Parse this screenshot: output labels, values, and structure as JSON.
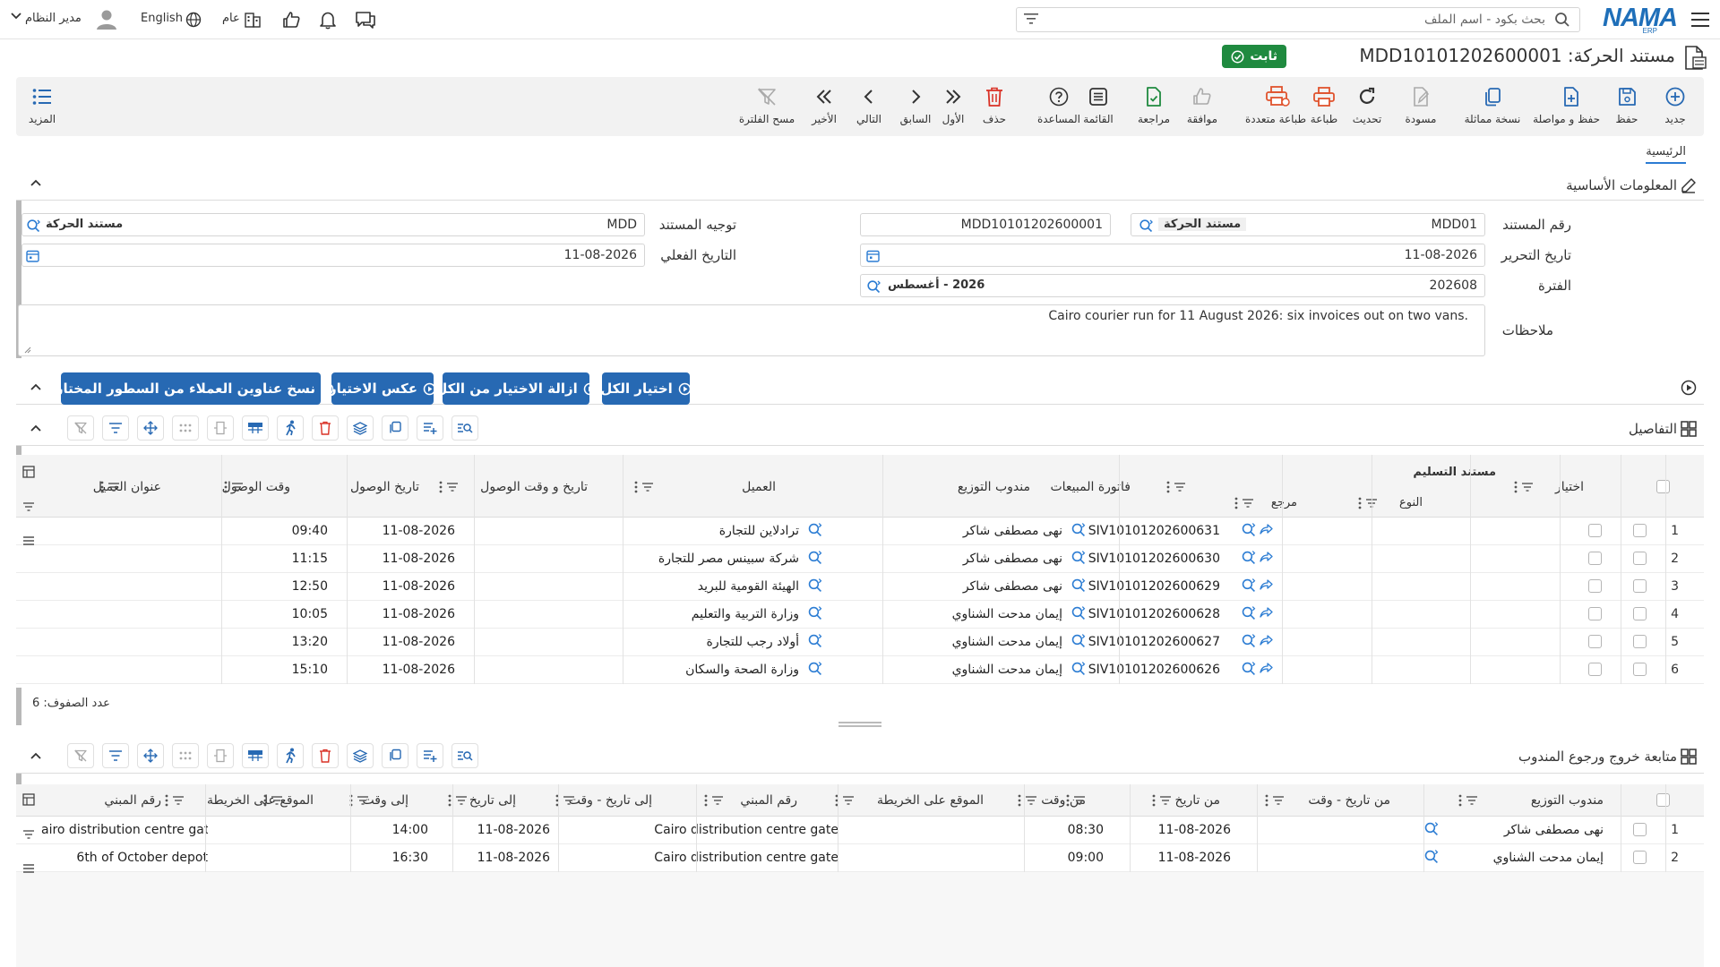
{
  "topbar": {
    "brand": "NAMA",
    "brand_sub": "ERP",
    "search_placeholder": "بحث بكود - اسم الملف",
    "user_name": "مدير النظام",
    "language": "English",
    "scope": "عام"
  },
  "title": {
    "label": "مستند الحركة: MDD10101202600001",
    "status": "ثابت"
  },
  "toolbar": [
    {
      "label": "جديد",
      "icon": "plus-circle-icon",
      "color": "#2769b3"
    },
    {
      "label": "حفظ",
      "icon": "save-icon",
      "color": "#2769b3"
    },
    {
      "label": "حفظ و مواصلة",
      "icon": "save-continue-icon",
      "color": "#2769b3"
    },
    {
      "label": "نسخة مماثلة",
      "icon": "copy-icon",
      "color": "#2769b3"
    },
    {
      "label": "مسودة",
      "icon": "draft-icon",
      "color": "#aaaaaa"
    },
    {
      "label": "تحديث",
      "icon": "refresh-icon",
      "color": "#333333"
    },
    {
      "label": "طباعة",
      "icon": "print-icon",
      "color": "#e0532d"
    },
    {
      "label": "طباعة متعددة",
      "icon": "multi-print-icon",
      "color": "#e0532d"
    },
    {
      "label": "موافقة",
      "icon": "thumbs-up-icon",
      "color": "#aaaaaa"
    },
    {
      "label": "مراجعة",
      "icon": "review-icon",
      "color": "#1f8a3f"
    },
    {
      "label": "القائمة",
      "icon": "list-icon",
      "color": "#333333"
    },
    {
      "label": "المساعدة",
      "icon": "help-icon",
      "color": "#333333"
    },
    {
      "label": "حذف",
      "icon": "trash-icon",
      "color": "#d93025"
    },
    {
      "label": "الأول",
      "icon": "first-icon",
      "color": "#333333"
    },
    {
      "label": "السابق",
      "icon": "prev-icon",
      "color": "#333333"
    },
    {
      "label": "التالي",
      "icon": "next-icon",
      "color": "#333333"
    },
    {
      "label": "الأخير",
      "icon": "last-icon",
      "color": "#333333"
    },
    {
      "label": "مسح الفلترة",
      "icon": "clear-filter-icon",
      "color": "#aaaaaa"
    }
  ],
  "more_label": "المزيد",
  "tabs": [
    "الرئيسية"
  ],
  "basic_info": {
    "section_title": "المعلومات الأساسية",
    "doc_number_label": "رقم المستند",
    "doc_number_code": "MDD01",
    "doc_number_type": "مستند الحركة",
    "doc_number_full": "MDD10101202600001",
    "doc_direction_label": "توجيه المستند",
    "doc_direction_code": "MDD",
    "doc_direction_name": "مستند الحركة",
    "edit_date_label": "تاريخ التحرير",
    "edit_date": "11-08-2026",
    "actual_date_label": "التاريخ الفعلي",
    "actual_date": "11-08-2026",
    "period_label": "الفترة",
    "period_code": "202608",
    "period_name": "2026 - أغسطس",
    "notes_label": "ملاحظات",
    "notes": "Cairo courier run for 11 August 2026: six invoices out on two vans."
  },
  "actions": {
    "select_all": "اختيار الكل",
    "deselect_all": "ازالة الاختيار من الكل",
    "invert": "عكس الاختيار",
    "copy_addresses": "نسخ عناوين العملاء من السطور المختارة"
  },
  "details": {
    "section_title": "التفاصيل",
    "group_header": "مستند التسليم",
    "headers": {
      "select": "اختيار",
      "type": "النوع",
      "ref": "مرجع",
      "invoice": "فاتورة المبيعات",
      "rep": "مندوب التوزيع",
      "customer": "العميل",
      "arrival_dt": "تاريخ و وقت الوصول",
      "arrival_date": "تاريخ الوصول",
      "arrival_time": "وقت الوصول",
      "address": "عنوان العميل"
    },
    "rows": [
      {
        "n": "1",
        "invoice": "SIV10101202600631",
        "rep": "نهى مصطفى شاكر",
        "customer": "ترادلاين للتجارة",
        "date": "11-08-2026",
        "time": "09:40"
      },
      {
        "n": "2",
        "invoice": "SIV10101202600630",
        "rep": "نهى مصطفى شاكر",
        "customer": "شركة سبينس مصر للتجارة",
        "date": "11-08-2026",
        "time": "11:15"
      },
      {
        "n": "3",
        "invoice": "SIV10101202600629",
        "rep": "نهى مصطفى شاكر",
        "customer": "الهيئة القومية للبريد",
        "date": "11-08-2026",
        "time": "12:50"
      },
      {
        "n": "4",
        "invoice": "SIV10101202600628",
        "rep": "إيمان مدحت الشناوي",
        "customer": "وزارة التربية والتعليم",
        "date": "11-08-2026",
        "time": "10:05"
      },
      {
        "n": "5",
        "invoice": "SIV10101202600627",
        "rep": "إيمان مدحت الشناوي",
        "customer": "أولاد رجب للتجارة",
        "date": "11-08-2026",
        "time": "13:20"
      },
      {
        "n": "6",
        "invoice": "SIV10101202600626",
        "rep": "إيمان مدحت الشناوي",
        "customer": "وزارة الصحة والسكان",
        "date": "11-08-2026",
        "time": "15:10"
      }
    ],
    "row_count": "عدد الصفوف: 6"
  },
  "tracking": {
    "section_title": "متابعة خروج ورجوع المندوب",
    "headers": {
      "rep": "مندوب التوزيع",
      "from_dt": "من تاريخ - وقت",
      "from_date": "من تاريخ",
      "from_time": "من وقت",
      "from_map": "الموقع على الخريطة",
      "from_building": "رقم المبني",
      "to_dt": "إلى تاريخ - وقت",
      "to_date": "إلى تاريخ",
      "to_time": "إلى وقت",
      "to_map": "الموقع على الخريطة",
      "to_building": "رقم المبني"
    },
    "rows": [
      {
        "n": "1",
        "rep": "نهى مصطفى شاكر",
        "from_date": "11-08-2026",
        "from_time": "08:30",
        "from_building": "Cairo distribution centre gate",
        "to_date": "11-08-2026",
        "to_time": "14:00",
        "to_building": "airo distribution centre gate"
      },
      {
        "n": "2",
        "rep": "إيمان مدحت الشناوي",
        "from_date": "11-08-2026",
        "from_time": "09:00",
        "from_building": "Cairo distribution centre gate",
        "to_date": "11-08-2026",
        "to_time": "16:30",
        "to_building": "6th of October depot"
      }
    ]
  },
  "colors": {
    "accent": "#2769b3",
    "status_green": "#1f8a3f",
    "brand": "#1f6fb9"
  }
}
